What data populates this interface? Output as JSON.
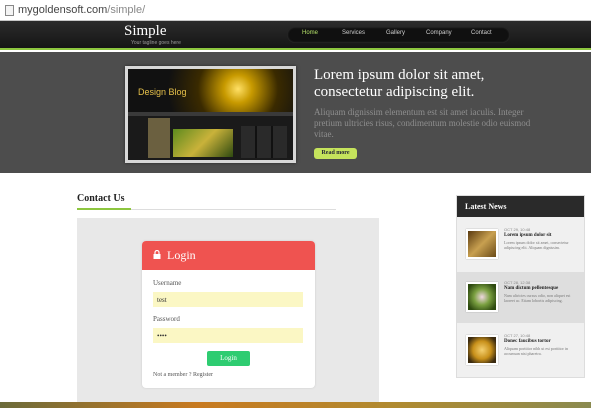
{
  "address_bar": {
    "domain": "mygoldensoft.com",
    "path": "/simple/"
  },
  "site": {
    "logo": "Simple",
    "tagline": "Your tagline goes here"
  },
  "nav": {
    "items": [
      "Home",
      "Services",
      "Gallery",
      "Company",
      "Contact"
    ],
    "active": "Home"
  },
  "hero": {
    "title": "Lorem ipsum dolor sit amet, consectetur adipiscing elit.",
    "text": "Aliquam dignissim elementum est sit amet iaculis. Integer pretium ultricies risus, condimentum molestie odio euismod vitae.",
    "button": "Read more",
    "preview_title": "Design Blog"
  },
  "contact": {
    "heading": "Contact Us",
    "login": {
      "title": "Login",
      "username_label": "Username",
      "username_value": "test",
      "password_label": "Password",
      "password_value": "••••",
      "button": "Login",
      "register_text": "Not a member ? Register"
    }
  },
  "news": {
    "heading": "Latest News",
    "items": [
      {
        "date": "OCT 29, 10:48",
        "title": "Lorem ipsum dolor sit",
        "text": "Lorem ipsum dolor sit amet, consectetur adipiscing elit. Aliquam dignissim.",
        "thumb": "#8a6a2a"
      },
      {
        "date": "OCT 28, 12:38",
        "title": "Nam dictum pellentesque",
        "text": "Nam ultricies cursus odio, non aliquet est laoreet ac. Etiam lobortis adipiscing.",
        "thumb": "#6a8a3a"
      },
      {
        "date": "OCT 27, 10:48",
        "title": "Donec faucibus tortor",
        "text": "Aliquam porttitor nibh ut est porttitor in accumsan nisi pharetra.",
        "thumb": "#c8a050"
      }
    ]
  },
  "colors": {
    "accent": "#8dc63f",
    "login_header": "#ef5350",
    "login_button": "#2ecc71"
  }
}
